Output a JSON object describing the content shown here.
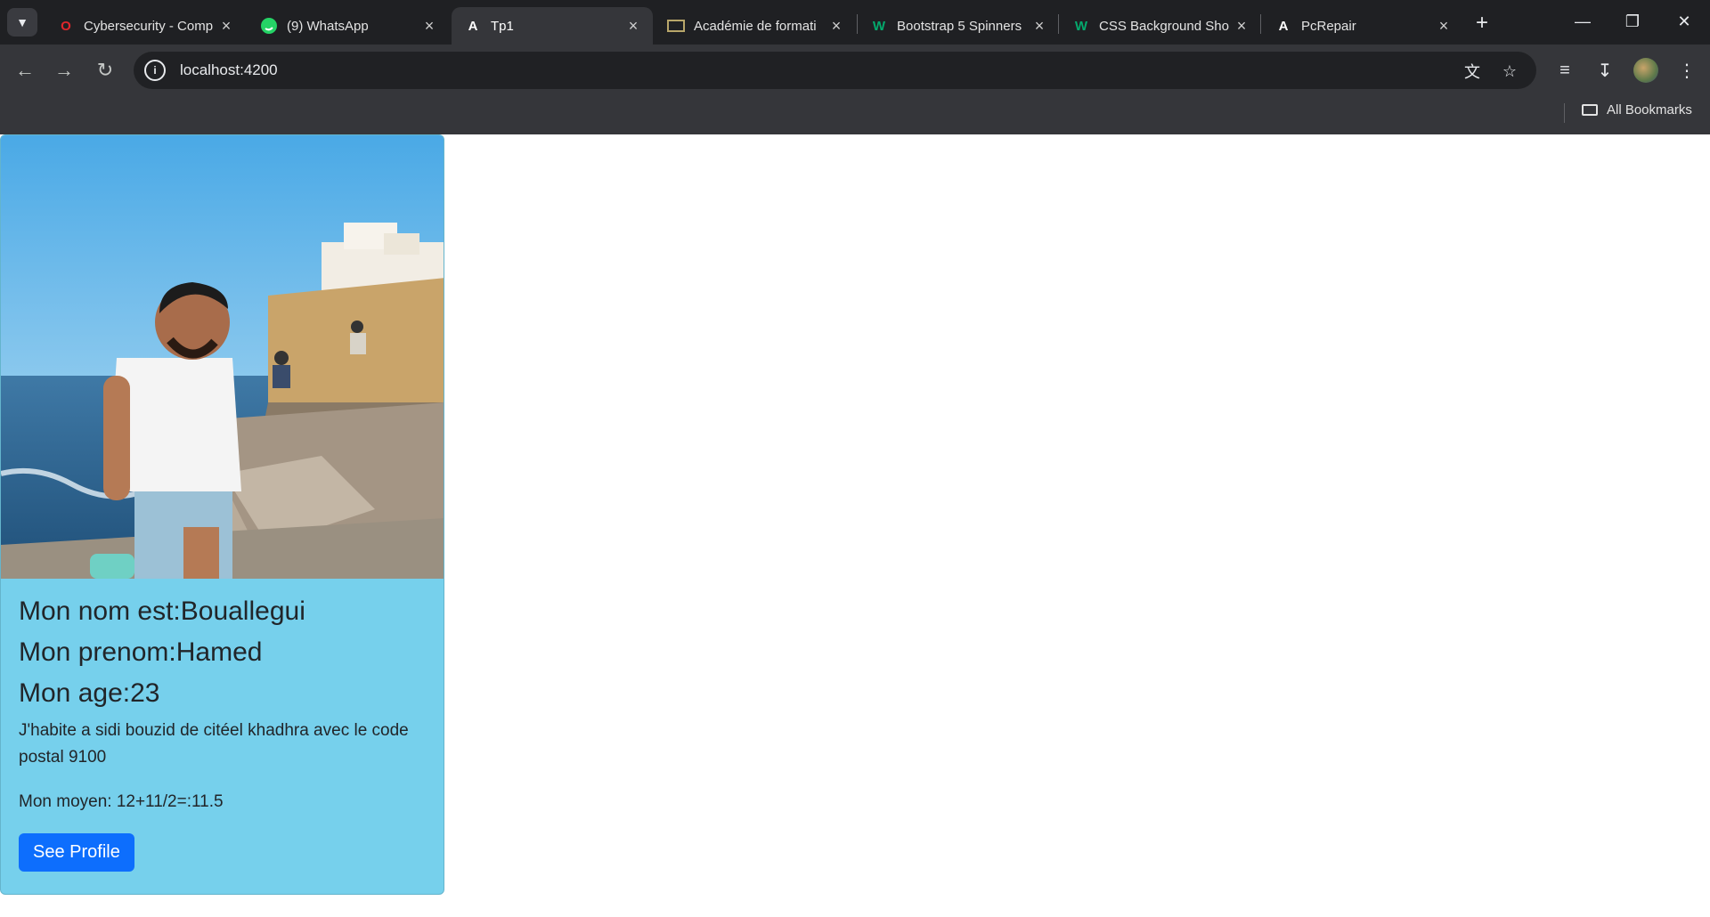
{
  "tabs": [
    {
      "title": "Cybersecurity - Comp",
      "favicon": "opera-icon",
      "color": "#e0262b"
    },
    {
      "title": "(9) WhatsApp",
      "favicon": "whatsapp-icon",
      "color": "#25d366"
    },
    {
      "title": "Tp1",
      "favicon": "angular-icon",
      "color": "#ffffff",
      "active": true
    },
    {
      "title": "Académie de formati",
      "favicon": "academy-icon",
      "color": "#b8a66a"
    },
    {
      "title": "Bootstrap 5 Spinners",
      "favicon": "w3schools-icon",
      "color": "#04aa6d"
    },
    {
      "title": "CSS Background Sho",
      "favicon": "w3schools-icon",
      "color": "#04aa6d"
    },
    {
      "title": "PcRepair",
      "favicon": "angular-icon",
      "color": "#ffffff"
    }
  ],
  "address_bar": {
    "url": "localhost:4200"
  },
  "bookmarks_bar": {
    "all_bookmarks": "All Bookmarks"
  },
  "card": {
    "nom": "Mon nom est:Bouallegui",
    "prenom": "Mon prenom:Hamed",
    "age": "Mon age:23",
    "adresse": "J'habite a sidi bouzid de citéel khadhra avec le code postal 9100",
    "moyen": "Mon moyen: 12+11/2=:11.5",
    "button": "See Profile",
    "background_color": "#76d0ec",
    "button_color": "#0d6efd"
  }
}
